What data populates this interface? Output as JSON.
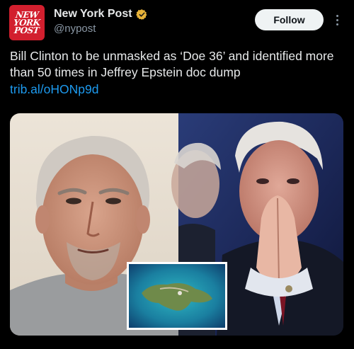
{
  "account": {
    "name": "New York Post",
    "handle": "@nypost",
    "avatar_text": [
      "NEW",
      "YORK",
      "POST"
    ],
    "verified_icon": "gold-verified-badge-icon",
    "avatar_color": "#d21f2e"
  },
  "actions": {
    "follow_label": "Follow",
    "more_icon": "more-vertical-icon"
  },
  "tweet": {
    "text": "Bill Clinton to be unmasked as ‘Doe 36’ and identified more than 50 times in Jeffrey Epstein doc dump",
    "link": "trib.al/oHONp9d"
  },
  "media": {
    "images": [
      "mugshot-photo",
      "speaker-photo",
      "island-inset-photo"
    ]
  },
  "colors": {
    "background": "#000000",
    "text": "#e7e9ea",
    "secondary_text": "#8b98a5",
    "link": "#1d9bf0",
    "verified": "#e8b339",
    "follow_bg": "#eff3f4"
  }
}
